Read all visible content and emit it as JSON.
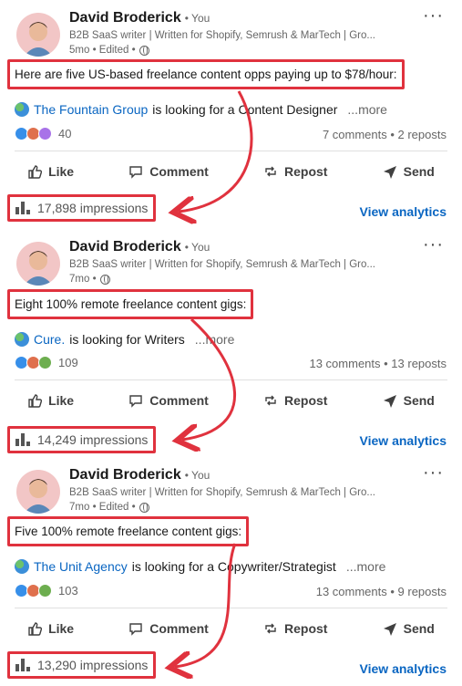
{
  "posts": [
    {
      "author": "David Broderick",
      "you_label": "• You",
      "headline": "B2B SaaS writer | Written for Shopify, Semrush & MarTech | Gro...",
      "age": "5mo • Edited •",
      "highlight_text": "Here are five US-based freelance content opps paying up to $78/hour:",
      "company": "The Fountain Group",
      "rest": "is looking for a Content Designer",
      "more": "...more",
      "reaction_count": "40",
      "stats": "7 comments • 2 reposts",
      "impressions": "17,898 impressions",
      "analytics": "View analytics"
    },
    {
      "author": "David Broderick",
      "you_label": "• You",
      "headline": "B2B SaaS writer | Written for Shopify, Semrush & MarTech | Gro...",
      "age": "7mo •",
      "highlight_text": "Eight 100% remote freelance content gigs:",
      "company": "Cure.",
      "rest": "is looking for Writers",
      "more": "...more",
      "reaction_count": "109",
      "stats": "13 comments • 13 reposts",
      "impressions": "14,249 impressions",
      "analytics": "View analytics"
    },
    {
      "author": "David Broderick",
      "you_label": "• You",
      "headline": "B2B SaaS writer | Written for Shopify, Semrush & MarTech | Gro...",
      "age": "7mo • Edited •",
      "highlight_text": "Five 100% remote freelance content gigs:",
      "company": "The Unit Agency",
      "rest": "is looking for a Copywriter/Strategist",
      "more": "...more",
      "reaction_count": "103",
      "stats": "13 comments • 9 reposts",
      "impressions": "13,290 impressions",
      "analytics": "View analytics"
    }
  ],
  "actions": {
    "like": "Like",
    "comment": "Comment",
    "repost": "Repost",
    "send": "Send"
  },
  "menu_glyph": "···",
  "colors": {
    "highlight_border": "#e0323e",
    "link": "#0a66c2",
    "muted_text": "#666666"
  }
}
